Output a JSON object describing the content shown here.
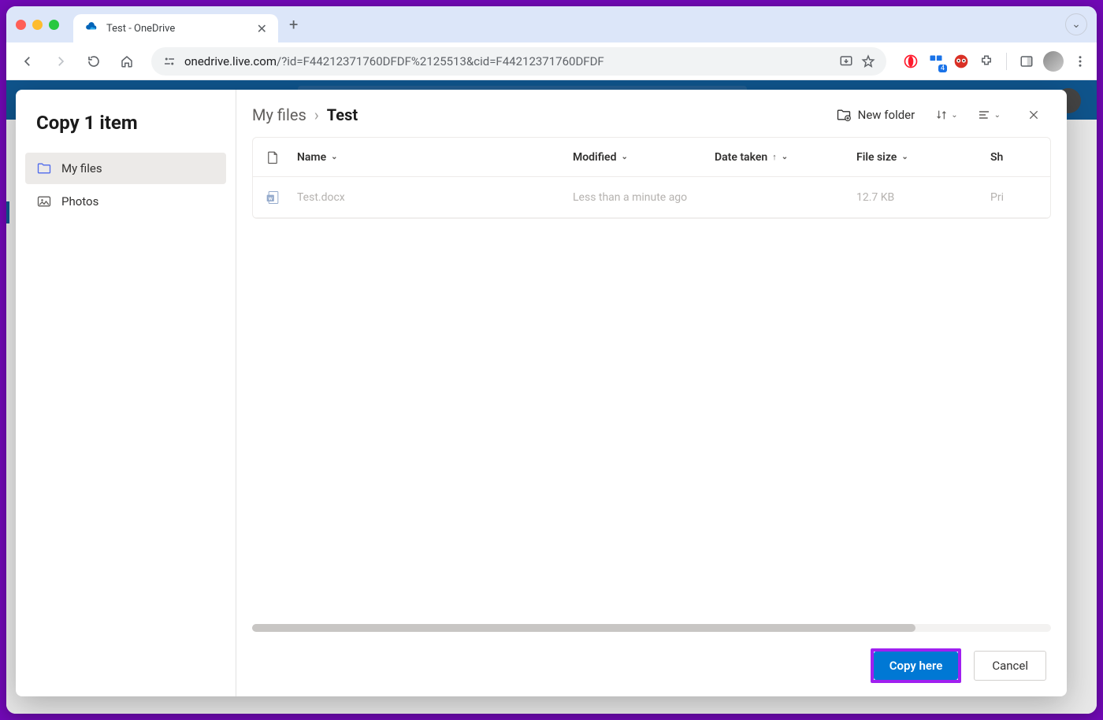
{
  "browser": {
    "tab_title": "Test - OneDrive",
    "url_domain": "onedrive.live.com",
    "url_path": "/?id=F44212371760DFDF%2125513&cid=F44212371760DFDF",
    "extension_badge": "4"
  },
  "modal": {
    "title": "Copy 1 item",
    "sidebar": {
      "items": [
        {
          "label": "My files",
          "active": true
        },
        {
          "label": "Photos",
          "active": false
        }
      ]
    },
    "breadcrumb": {
      "parts": [
        "My files"
      ],
      "current": "Test"
    },
    "actions": {
      "new_folder": "New folder"
    },
    "table": {
      "columns": {
        "name": "Name",
        "modified": "Modified",
        "date_taken": "Date taken",
        "file_size": "File size",
        "sharing": "Sh"
      },
      "rows": [
        {
          "name": "Test.docx",
          "modified": "Less than a minute ago",
          "date_taken": "",
          "size": "12.7 KB",
          "sharing": "Pri"
        }
      ]
    },
    "footer": {
      "primary": "Copy here",
      "secondary": "Cancel"
    }
  }
}
